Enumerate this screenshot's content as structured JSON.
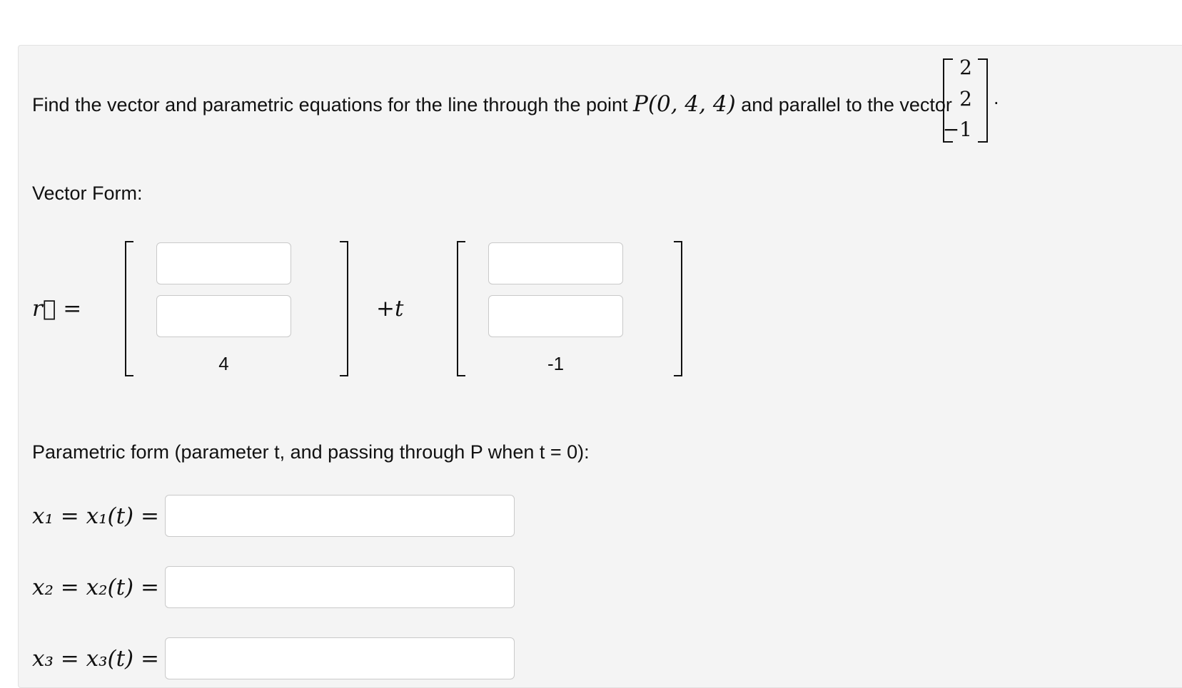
{
  "question": {
    "text_before": "Find the vector and parametric equations for the line through the point",
    "point": "P(0, 4, 4)",
    "text_after": "and parallel to the vector",
    "vector": [
      "2",
      "2",
      "−1"
    ],
    "period": "."
  },
  "vector_form": {
    "label": "Vector Form:",
    "lhs": "r⃗ =",
    "point_static": "4",
    "plus_t": "+t",
    "dir_static": "-1"
  },
  "parametric": {
    "label": "Parametric form (parameter t, and passing through P when t = 0):",
    "rows": [
      {
        "lhs": "x₁ = x₁(t) ="
      },
      {
        "lhs": "x₂ = x₂(t) ="
      },
      {
        "lhs": "x₃ = x₃(t) ="
      }
    ]
  }
}
